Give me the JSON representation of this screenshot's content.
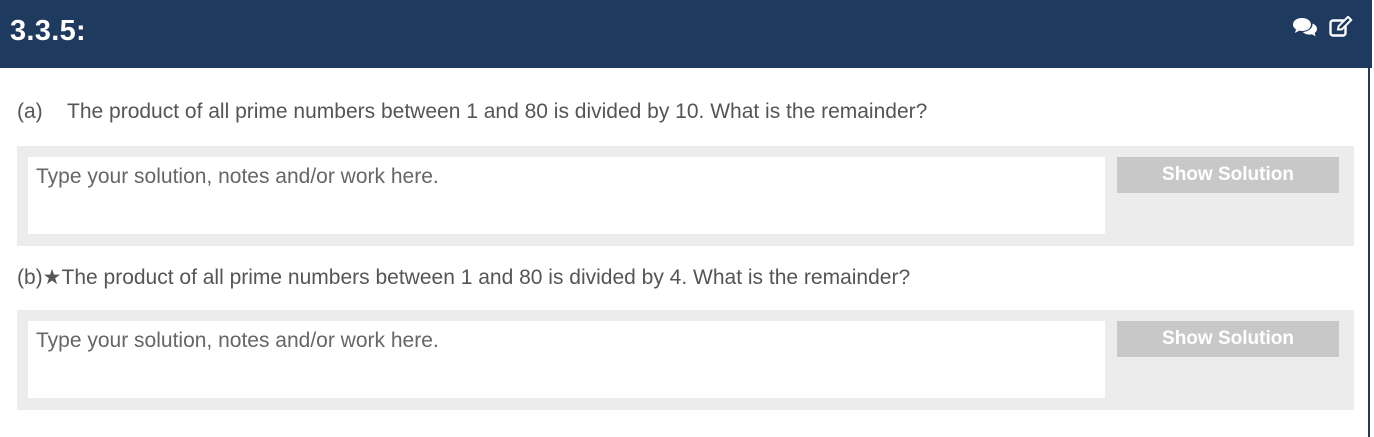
{
  "header": {
    "title": "3.3.5:",
    "icons": [
      "comments-icon",
      "edit-icon"
    ]
  },
  "questions": [
    {
      "label": "(a)",
      "starred": false,
      "text": "The product of all prime numbers between 1 and 80 is divided by 10. What is the remainder?",
      "answer_placeholder": "Type your solution, notes and/or work here.",
      "answer_value": "",
      "show_solution_label": "Show Solution"
    },
    {
      "label": "(b)",
      "starred": true,
      "star_glyph": "★",
      "text": "The product of all prime numbers between 1 and 80 is divided by 4. What is the remainder?",
      "answer_placeholder": "Type your solution, notes and/or work here.",
      "answer_value": "",
      "show_solution_label": "Show Solution"
    }
  ],
  "colors": {
    "header_bg": "#1f3a5f",
    "answer_block_bg": "#ececec",
    "button_bg": "#c8c8c8",
    "text": "#555555"
  }
}
